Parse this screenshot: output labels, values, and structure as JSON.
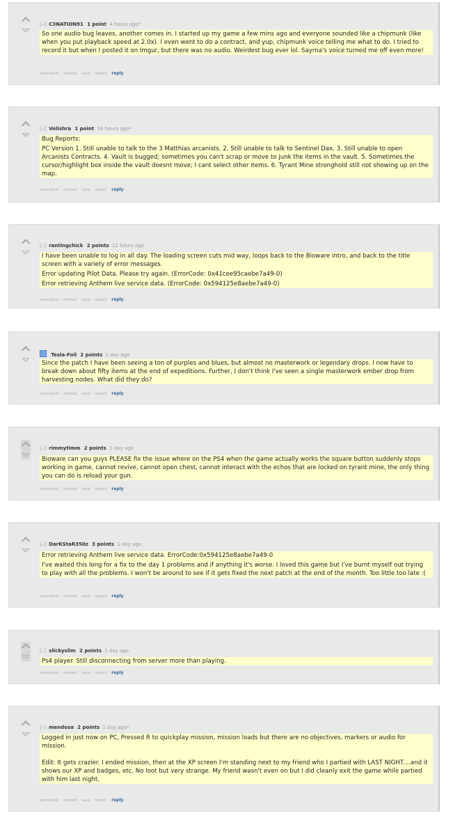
{
  "comments": [
    {
      "collapse": "[–]",
      "author": "C3NATION91",
      "score": "1 point",
      "time": "4 hours ago*",
      "body": [
        "So one audio bug leaves, another comes in. I started up my game a few mins ago and everyone sounded like a chipmunk (like when you put playback speed at 2.0x). I even went to do a contract, and yup, chipmunk voice telling me what to do. I tried to record it but when I posted it on Imgur, but there was no audio. Weirdest bug ever lol. Sayrna's voice turned me off even more!"
      ],
      "buttons": {
        "permalink": "permalink",
        "embed": "embed",
        "save": "save",
        "report": "report",
        "reply": "reply"
      }
    },
    {
      "collapse": "[–]",
      "author": "Velishra",
      "score": "1 point",
      "time": "16 hours ago*",
      "body": [
        "Bug Reports:",
        "PC Version 1. Still unable to talk to the 3 Matthias arcanists. 2. Still unable to talk to Sentinel Dax. 3. Still unable to open Arcanists Contracts. 4. Vault is bugged; sometimes you can't scrap or move to junk the items in the vault. 5. Sometimes the cursor/highlight box inside the vault doesnt move; I cant select other items. 6. Tyrant Mine stronghold still not showing up on the map."
      ],
      "buttons": {
        "permalink": "permalink",
        "embed": "embed",
        "save": "save",
        "report": "report",
        "reply": "reply"
      }
    },
    {
      "collapse": "[–]",
      "author": "rantingchick",
      "score": "2 points",
      "time": "22 hours ago",
      "body": [
        "I have been unable to log in all day. The loading screen cuts mid way, loops back to the Bioware intro, and back to the title screen with a variety of error messages.",
        "Error updating Pilot Data. Please try again. (ErrorCode: 0x41cee95caebe7a49-0)",
        "Error retrieving Anthem live service data. (ErrorCode: 0x594125e8aebe7a49-0)"
      ],
      "buttons": {
        "permalink": "permalink",
        "embed": "embed",
        "save": "save",
        "report": "report",
        "reply": "reply"
      }
    },
    {
      "collapse": "",
      "author": "Tesla-Foil",
      "score": "2 points",
      "time": "1 day ago",
      "body": [
        "Since the patch I have been seeing a ton of purples and blues, but almost no masterwork or legendary drops. I now have to break down about fifty items at the end of expeditions. Further, I don't think I've seen a single masterwork ember drop from harvesting nodes. What did they do?"
      ],
      "buttons": {
        "permalink": "permalink",
        "embed": "embed",
        "save": "save",
        "report": "report",
        "reply": "reply"
      }
    },
    {
      "collapse": "[–]",
      "author": "rimmytimm",
      "score": "2 points",
      "time": "1 day ago",
      "body": [
        "Bioware can you guys PLEASE fix the issue where on the PS4 when the game actually works the square button suddenly stops working in game, cannot revive, cannot open chest, cannot interact with the echos that are locked on tyrant mine, the only thing you can do is reload your gun."
      ],
      "buttons": {
        "permalink": "permalink",
        "embed": "embed",
        "save": "save",
        "report": "report",
        "reply": "reply"
      }
    },
    {
      "collapse": "[–]",
      "author": "DarKStaR350z",
      "score": "3 points",
      "time": "1 day ago",
      "body": [
        "Error retrieving Anthem live service data. ErrorCode:0x594125e8aebe7a49-0",
        "I've waited this long for a fix to the day 1 problems and if anything it's worse. I loved this game but I've burnt myself out trying to play with all the problems. I won't be around to see if it gets fixed the next patch at the end of the month. Too little too late :("
      ],
      "buttons": {
        "permalink": "permalink",
        "embed": "embed",
        "save": "save",
        "report": "report",
        "reply": "reply"
      }
    },
    {
      "collapse": "[–]",
      "author": "slickyslim",
      "score": "2 points",
      "time": "1 day ago",
      "body": [
        "Ps4 player. Still disconnecting from server more than playing."
      ],
      "buttons": {
        "permalink": "permalink",
        "embed": "embed",
        "save": "save",
        "report": "report",
        "reply": "reply"
      }
    },
    {
      "collapse": "[–]",
      "author": "mendosa",
      "score": "2 points",
      "time": "1 day ago*",
      "body": [
        "Logged in just now on PC, Pressed R to quickplay mission, mission loads but there are no objectives, markers or audio for mission.",
        "Edit: It gets crazier. I ended mission, then at the XP screen I'm standing next to my friend who I partied with LAST NIGHT....and it shows our XP and badges, etc. No loot but very strange. My friend wasn't even on but I did cleanly exit the game while partied with him last night."
      ],
      "buttons": {
        "permalink": "permalink",
        "embed": "embed",
        "save": "save",
        "report": "report",
        "reply": "reply"
      }
    }
  ],
  "colors": {
    "comment_bg": "#e9e9e9",
    "body_highlight": "#ffffcc",
    "reply_link": "#336699"
  },
  "icons": {
    "upvote": "upvote-arrow-icon",
    "downvote": "downvote-arrow-icon",
    "flair": "flair-icon"
  }
}
